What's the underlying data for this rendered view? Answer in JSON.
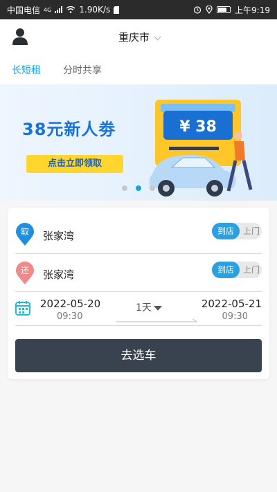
{
  "status_bar": {
    "carrier": "中国电信",
    "net_type": "4G",
    "speed": "1.90K/s",
    "time": "上午9:19"
  },
  "header": {
    "city": "重庆市"
  },
  "tabs": [
    {
      "label": "长短租",
      "active": true
    },
    {
      "label": "分时共享",
      "active": false
    }
  ],
  "banner": {
    "title": "38元新人劵",
    "button": "点击立即领取",
    "coupon_amount": "¥ 38",
    "page_count": 3,
    "active_page": 2
  },
  "rental": {
    "pickup": {
      "badge": "取",
      "location": "张家湾",
      "mode_on": "到店",
      "mode_off": "上门"
    },
    "return": {
      "badge": "还",
      "location": "张家湾",
      "mode_on": "到店",
      "mode_off": "上门"
    },
    "start_date": "2022-05-20",
    "start_time": "09:30",
    "end_date": "2022-05-21",
    "end_time": "09:30",
    "duration": "1天",
    "submit": "去选车"
  },
  "colors": {
    "accent": "#14a4e0",
    "toggle_on": "#2aa0e0",
    "button": "#38434f",
    "pickup_pin": "#1e8fe0",
    "return_pin": "#f08a8a"
  }
}
